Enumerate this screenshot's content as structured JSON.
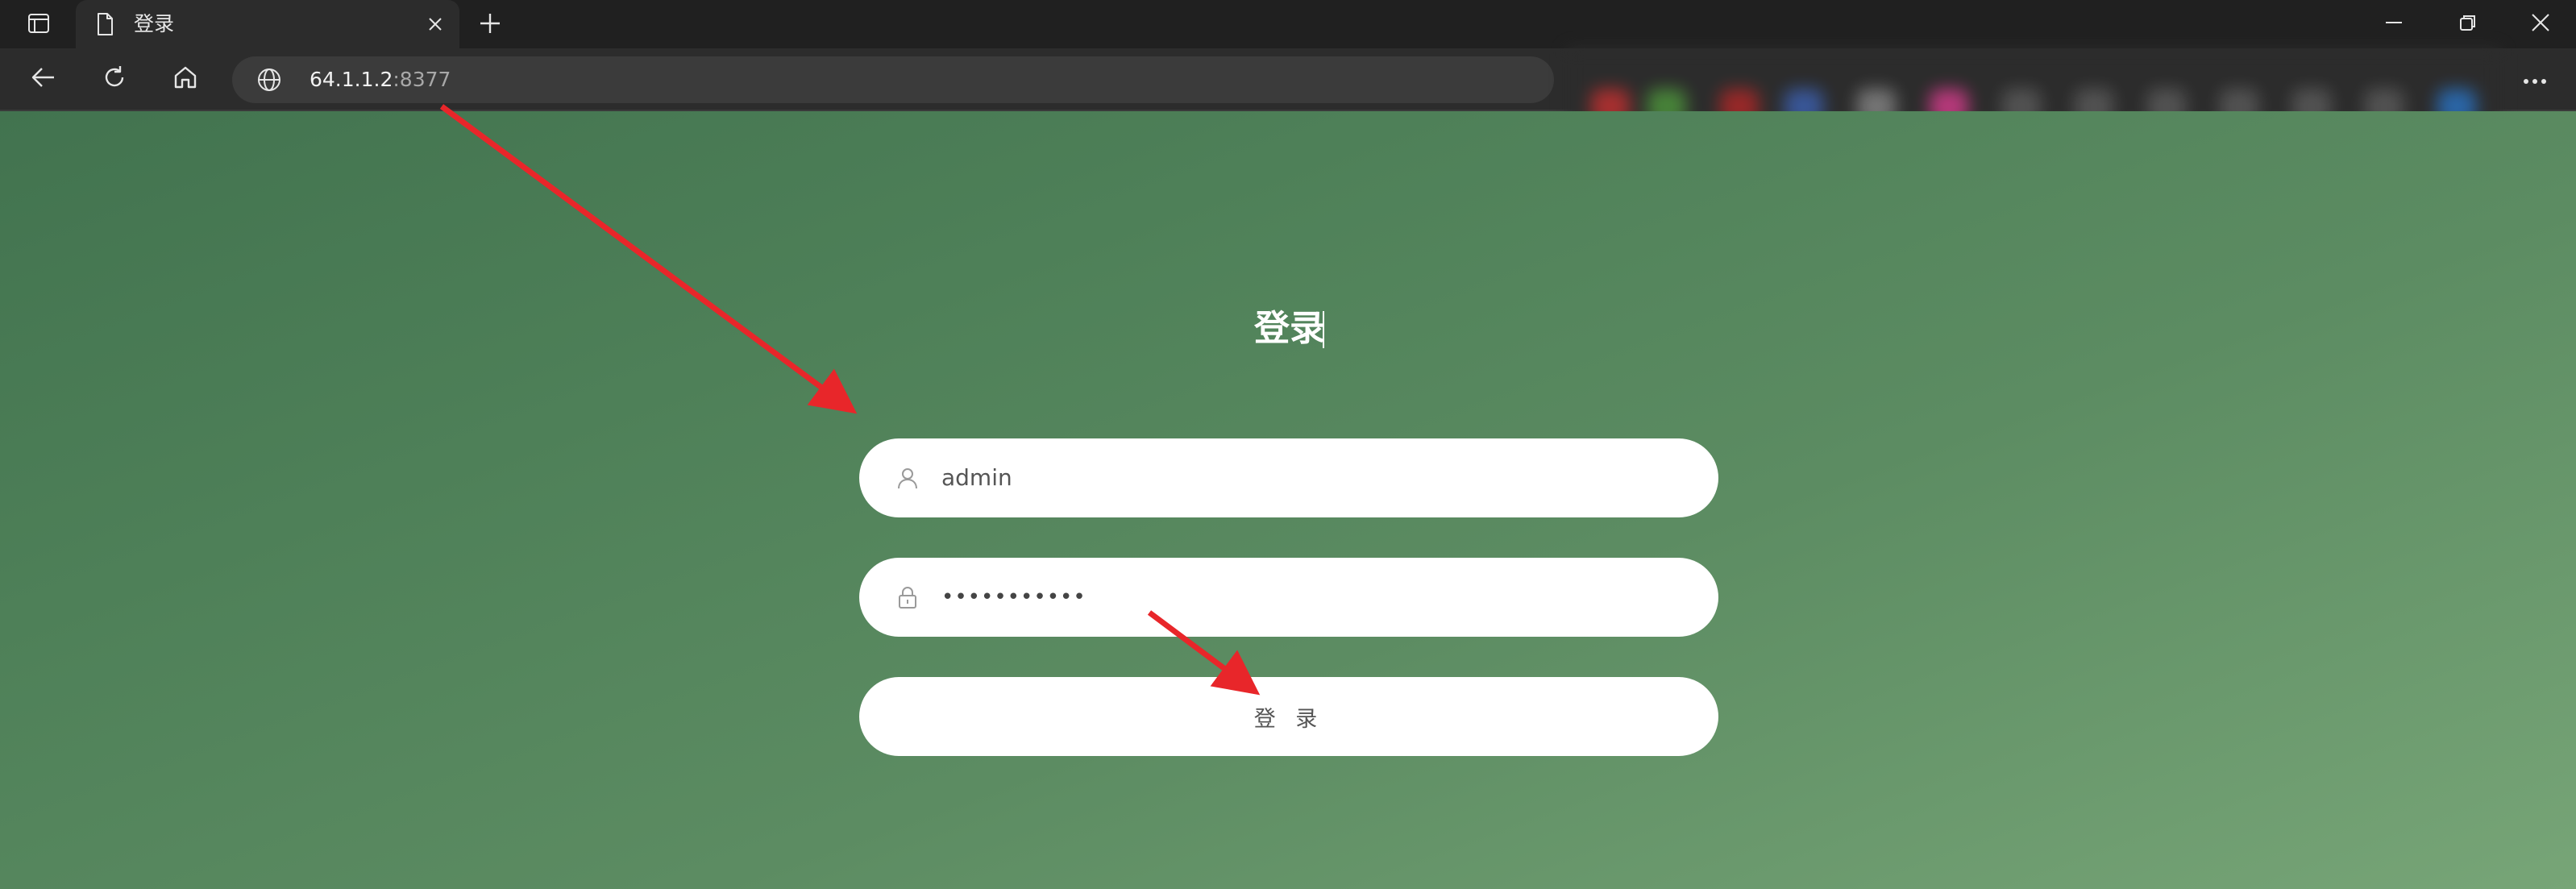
{
  "browser": {
    "tab": {
      "title": "登录",
      "favicon": "page-icon"
    },
    "new_tab_icon": "plus-icon",
    "window_controls": [
      "minimize-icon",
      "restore-icon",
      "close-icon"
    ],
    "toolbar": {
      "back_icon": "back-arrow-icon",
      "refresh_icon": "refresh-icon",
      "home_icon": "home-icon",
      "more_icon": "more-icon"
    },
    "address_bar": {
      "host": "64.1.1.2",
      "port": ":8377",
      "site_icon": "globe-icon"
    }
  },
  "login": {
    "title": "登录",
    "username": {
      "value": "admin",
      "icon": "user-icon"
    },
    "password": {
      "value": "•••••••••••",
      "icon": "lock-icon"
    },
    "submit_label": "登 录"
  },
  "colors": {
    "titlebar": "#202020",
    "toolbar": "#2c2c2c",
    "address_bar": "#3b3b3b",
    "page_gradient_start": "#42734f",
    "page_gradient_end": "#77a577",
    "annotation_arrow": "#e8262a",
    "field_background": "#ffffff"
  }
}
